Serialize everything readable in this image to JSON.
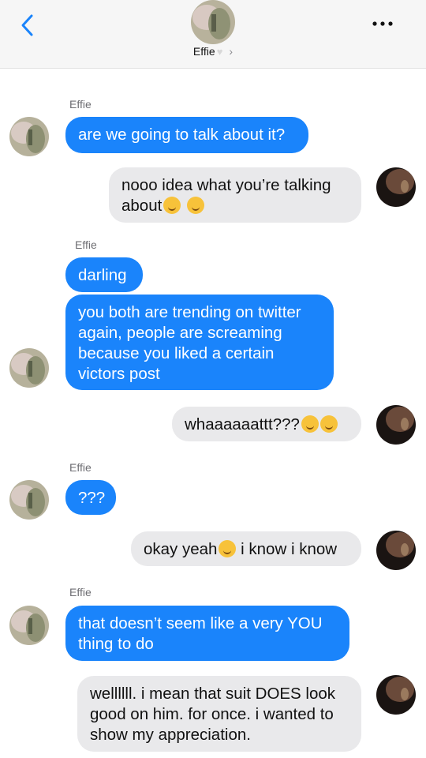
{
  "header": {
    "contact_name": "Effie",
    "heart": "♥",
    "chevron": "›",
    "back_icon": "chevron-left-icon",
    "more_icon": "more-dots-icon"
  },
  "messages": [
    {
      "sender": "Effie",
      "text": "are we going to talk about it?"
    },
    {
      "text": "nooo idea what you’re talking\nabout"
    },
    {
      "sender": "Effie",
      "text": "darling"
    },
    {
      "text": "you both are trending on twitter\nagain, people are screaming\nbecause you liked a certain\nvictors post"
    },
    {
      "text": "whaaaaaattt???"
    },
    {
      "sender": "Effie",
      "text": "???"
    },
    {
      "text_a": "okay yeah",
      "text_b": " i know i know"
    },
    {
      "sender": "Effie",
      "text": "that doesn’t seem like a very YOU\nthing to do"
    },
    {
      "text": "wellllll. i mean that suit DOES look\ngood on him. for once. i wanted to\nshow my appreciation."
    }
  ],
  "colors": {
    "incoming": "#1a84fb",
    "outgoing": "#e9e9eb",
    "accent": "#1a84fb"
  }
}
